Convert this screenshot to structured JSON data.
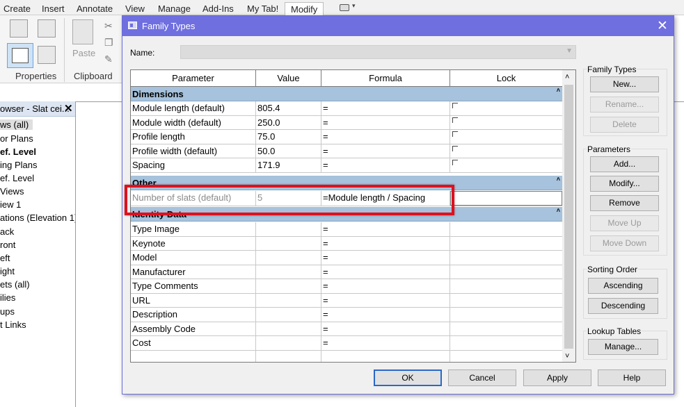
{
  "ribbon": {
    "tabs": [
      "Create",
      "Insert",
      "Annotate",
      "View",
      "Manage",
      "Add-Ins",
      "My Tab!",
      "Modify"
    ],
    "active_tab": "Modify",
    "groups": {
      "properties": "Properties",
      "clipboard": "Clipboard"
    },
    "paste_label": "Paste"
  },
  "browser": {
    "title": "owser - Slat cei...",
    "items": [
      "ws (all)",
      "or Plans",
      "ef. Level",
      "ing Plans",
      "ef. Level",
      "Views",
      "iew 1",
      "ations (Elevation 1)",
      "ack",
      "ront",
      "eft",
      "ight",
      "ets (all)",
      "ilies",
      "ups",
      "t Links"
    ]
  },
  "dialog": {
    "title": "Family Types",
    "name_label": "Name:",
    "name_value": "",
    "columns": [
      "Parameter",
      "Value",
      "Formula",
      "Lock"
    ],
    "groups": [
      {
        "label": "Dimensions",
        "rows": [
          {
            "parameter": "Module length (default)",
            "value": "805.4",
            "formula": "=",
            "lock": true
          },
          {
            "parameter": "Module width (default)",
            "value": "250.0",
            "formula": "=",
            "lock": true
          },
          {
            "parameter": "Profile length",
            "value": "75.0",
            "formula": "=",
            "lock": true
          },
          {
            "parameter": "Profile width (default)",
            "value": "50.0",
            "formula": "=",
            "lock": true
          },
          {
            "parameter": "Spacing",
            "value": "171.9",
            "formula": "=",
            "lock": true
          }
        ]
      },
      {
        "label": "Other",
        "rows": [
          {
            "parameter": "Number of slats (default)",
            "value": "5",
            "formula": "=Module length / Spacing",
            "lock": false
          }
        ]
      },
      {
        "label": "Identity Data",
        "rows": [
          {
            "parameter": "Type Image",
            "value": "",
            "formula": "=",
            "lock": false
          },
          {
            "parameter": "Keynote",
            "value": "",
            "formula": "=",
            "lock": false
          },
          {
            "parameter": "Model",
            "value": "",
            "formula": "=",
            "lock": false
          },
          {
            "parameter": "Manufacturer",
            "value": "",
            "formula": "=",
            "lock": false
          },
          {
            "parameter": "Type Comments",
            "value": "",
            "formula": "=",
            "lock": false
          },
          {
            "parameter": "URL",
            "value": "",
            "formula": "=",
            "lock": false
          },
          {
            "parameter": "Description",
            "value": "",
            "formula": "=",
            "lock": false
          },
          {
            "parameter": "Assembly Code",
            "value": "",
            "formula": "=",
            "lock": false
          },
          {
            "parameter": "Cost",
            "value": "",
            "formula": "=",
            "lock": false
          }
        ]
      }
    ],
    "family_types": {
      "title": "Family Types",
      "new": "New...",
      "rename": "Rename...",
      "delete": "Delete"
    },
    "parameters": {
      "title": "Parameters",
      "add": "Add...",
      "modify": "Modify...",
      "remove": "Remove",
      "move_up": "Move Up",
      "move_down": "Move Down"
    },
    "sorting": {
      "title": "Sorting Order",
      "ascending": "Ascending",
      "descending": "Descending"
    },
    "lookup": {
      "title": "Lookup Tables",
      "manage": "Manage..."
    },
    "buttons": {
      "ok": "OK",
      "cancel": "Cancel",
      "apply": "Apply",
      "help": "Help"
    }
  },
  "colors": {
    "titlebar": "#6f6fe0",
    "group_row": "#a6c2dc",
    "highlight": "#e0101e"
  }
}
